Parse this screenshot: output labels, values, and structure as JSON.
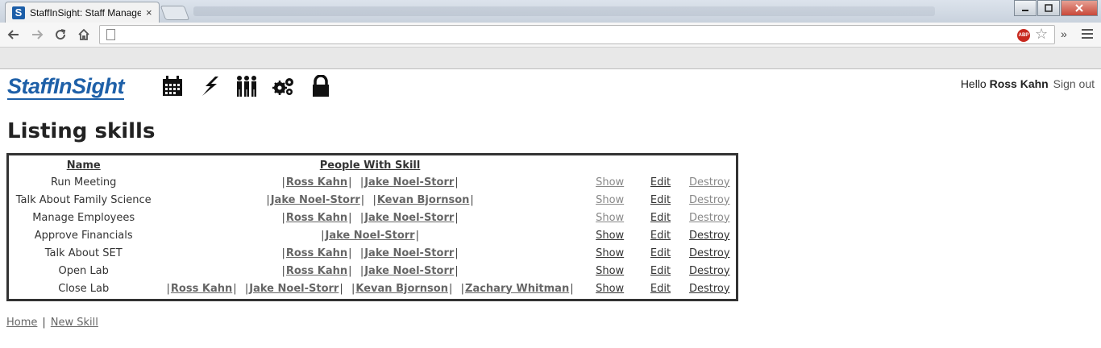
{
  "browser": {
    "tab_title": "StaffInSight: Staff Manage",
    "tab_close": "×",
    "favicon_letter": "S",
    "abp_label": "ABP",
    "more_label": "»"
  },
  "header": {
    "logo": "StaffInSight",
    "nav_icons": [
      "calendar-icon",
      "lightning-icon",
      "people-icon",
      "gears-icon",
      "lock-icon"
    ],
    "greeting_prefix": "Hello ",
    "user_name": "Ross Kahn",
    "sign_out": "Sign out"
  },
  "main": {
    "title": "Listing skills",
    "columns": {
      "name": "Name",
      "people": "People With Skill"
    },
    "actions": {
      "show": "Show",
      "edit": "Edit",
      "destroy": "Destroy"
    },
    "rows": [
      {
        "name": "Run Meeting",
        "people": [
          "Ross Kahn",
          "Jake Noel-Storr"
        ],
        "muted": true
      },
      {
        "name": "Talk About Family Science",
        "people": [
          "Jake Noel-Storr",
          "Kevan Bjornson"
        ],
        "muted": true
      },
      {
        "name": "Manage Employees",
        "people": [
          "Ross Kahn",
          "Jake Noel-Storr"
        ],
        "muted": true
      },
      {
        "name": "Approve Financials",
        "people": [
          "Jake Noel-Storr"
        ],
        "muted": false
      },
      {
        "name": "Talk About SET",
        "people": [
          "Ross Kahn",
          "Jake Noel-Storr"
        ],
        "muted": false
      },
      {
        "name": "Open Lab",
        "people": [
          "Ross Kahn",
          "Jake Noel-Storr"
        ],
        "muted": false
      },
      {
        "name": "Close Lab",
        "people": [
          "Ross Kahn",
          "Jake Noel-Storr",
          "Kevan Bjornson",
          "Zachary Whitman"
        ],
        "muted": false
      }
    ]
  },
  "footer": {
    "home": "Home",
    "separator": "|",
    "new_skill": "New Skill"
  },
  "colors": {
    "brand": "#1e60a8",
    "link": "#666666",
    "muted_link": "#888888"
  }
}
